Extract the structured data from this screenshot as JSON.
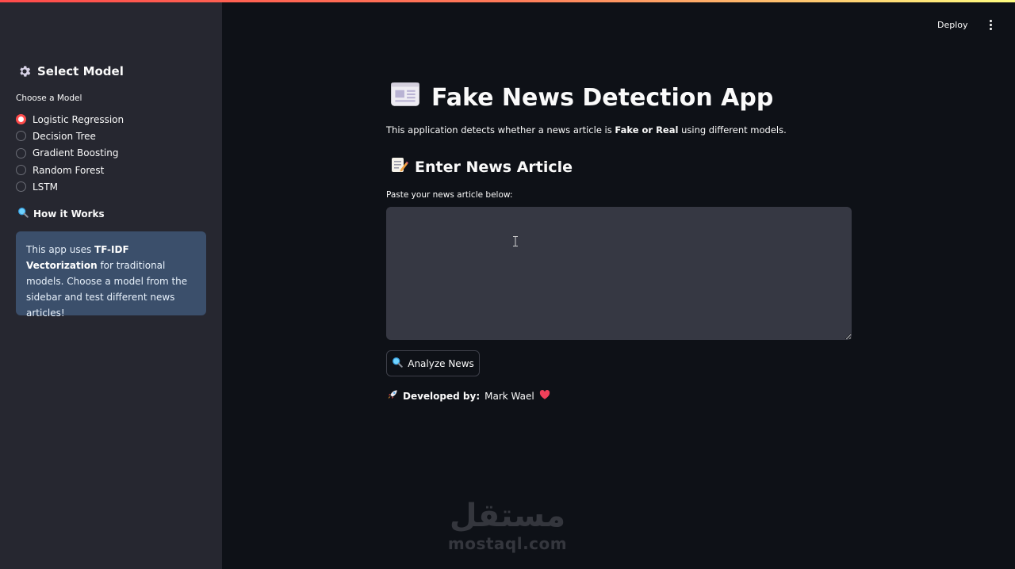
{
  "app": {
    "accent_color": "#ff4b4b",
    "background": "#0e1117",
    "sidebar_background": "#262730"
  },
  "header": {
    "deploy_label": "Deploy",
    "menu_icon": "more-vertical-icon"
  },
  "sidebar": {
    "heading": "Select Model",
    "heading_icon": "gear-icon",
    "radio_label": "Choose a Model",
    "models": [
      {
        "label": "Logistic Regression",
        "selected": true
      },
      {
        "label": "Decision Tree",
        "selected": false
      },
      {
        "label": "Gradient Boosting",
        "selected": false
      },
      {
        "label": "Random Forest",
        "selected": false
      },
      {
        "label": "LSTM",
        "selected": false
      }
    ],
    "how_heading": "How it Works",
    "how_icon": "magnifier-icon",
    "info": {
      "prefix": "This app uses ",
      "bold": "TF-IDF Vectorization",
      "suffix": " for traditional models. Choose a model from the sidebar and test different news articles!"
    }
  },
  "main": {
    "title": "Fake News Detection App",
    "title_icon": "newspaper-icon",
    "description_prefix": "This application detects whether a news article is ",
    "description_bold": "Fake or Real",
    "description_suffix": " using different models.",
    "subtitle": "Enter News Article",
    "subtitle_icon": "memo-icon",
    "textarea_label": "Paste your news article below:",
    "textarea_value": "",
    "analyze_button": "Analyze News",
    "analyze_icon": "magnifier-icon",
    "developer_label": "Developed by:",
    "developer_name": "Mark Wael",
    "developer_icon": "rocket-icon",
    "heart_icon": "heart-icon"
  },
  "watermark": {
    "arabic": "مستقل",
    "latin": "mostaql.com"
  }
}
